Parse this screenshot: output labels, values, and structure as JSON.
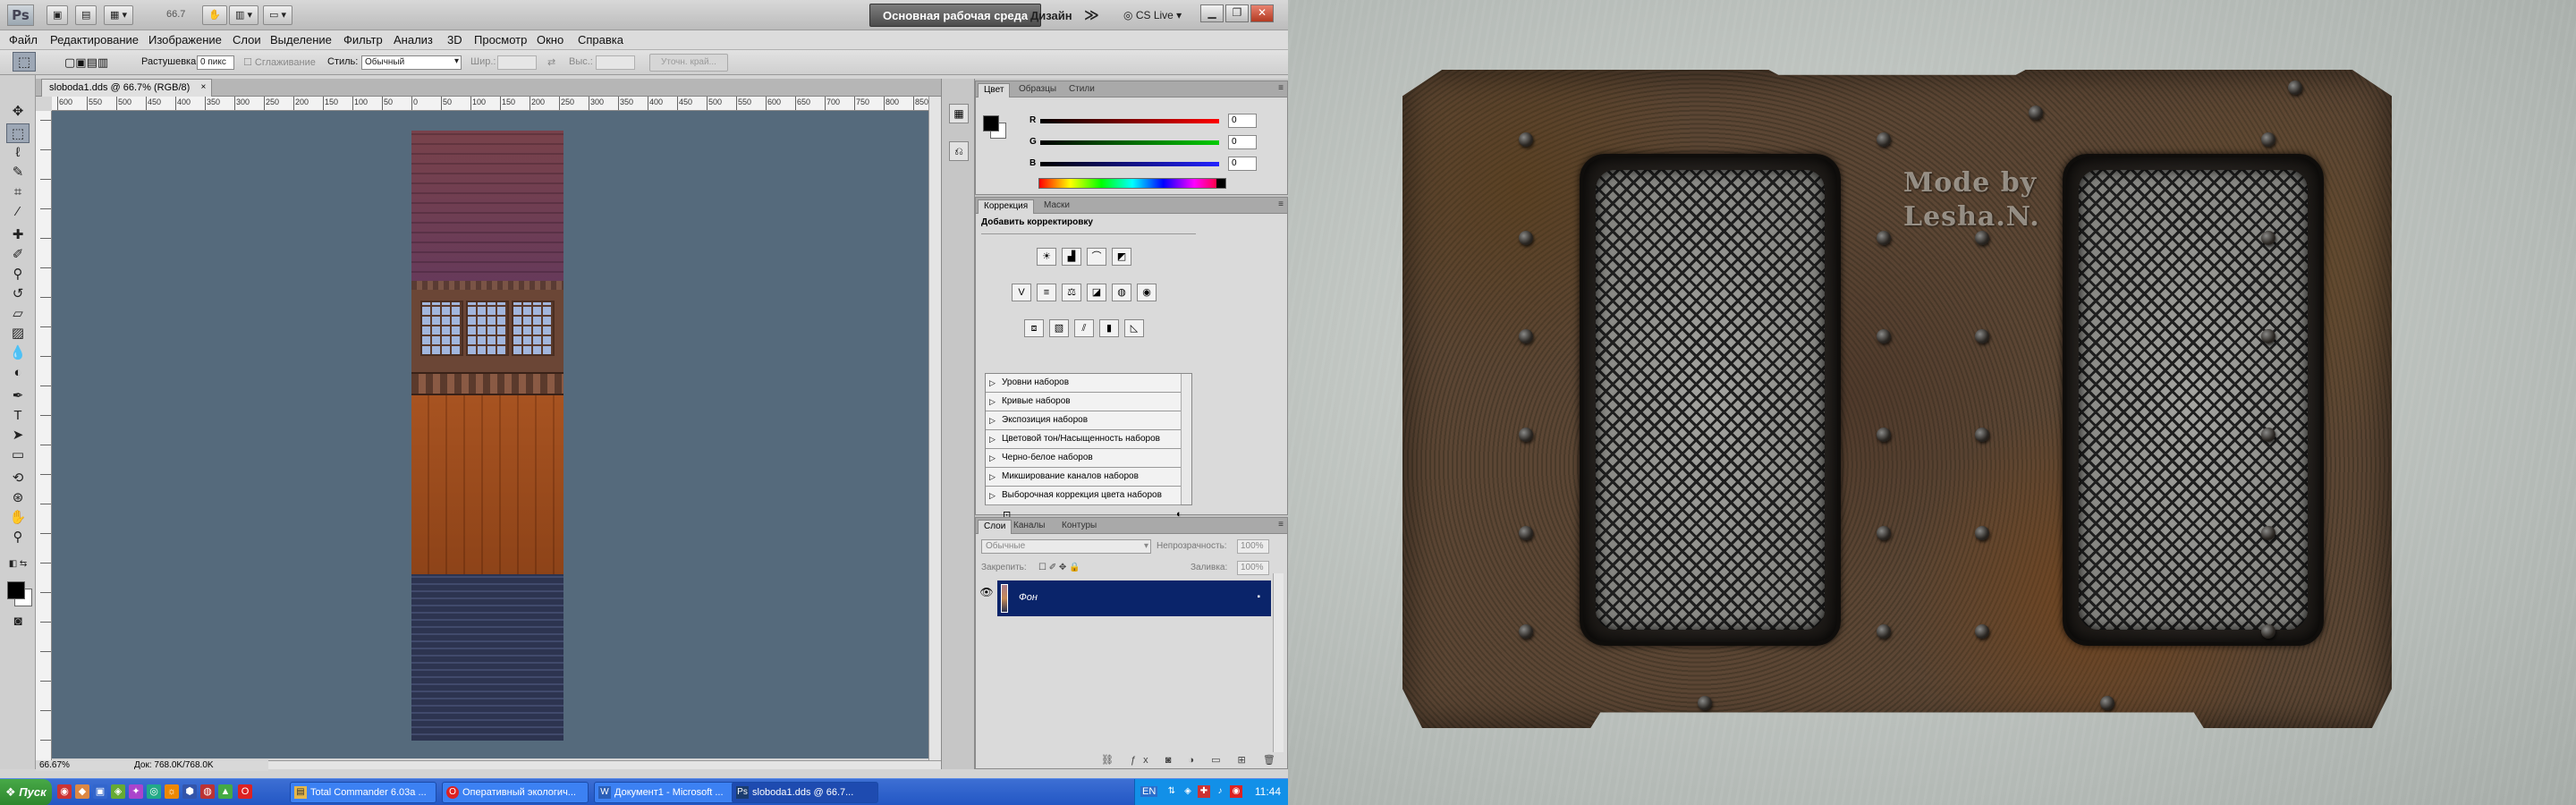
{
  "photoshop": {
    "appbar": {
      "logo": "Ps",
      "zoom": "66.7",
      "workspace_main": "Основная рабочая среда",
      "workspace_design": "Дизайн",
      "workspace_more": "≫",
      "cs_live": "CS Live"
    },
    "menu": [
      "Файл",
      "Редактирование",
      "Изображение",
      "Слои",
      "Выделение",
      "Фильтр",
      "Анализ",
      "3D",
      "Просмотр",
      "Окно",
      "Справка"
    ],
    "options": {
      "feather_label": "Растушевка:",
      "feather_value": "0 пикс",
      "antialias_label": "Сглаживание",
      "style_label": "Стиль:",
      "style_value": "Обычный",
      "width_label": "Шир.:",
      "height_label": "Выс.:",
      "refine_edge": "Уточн. край..."
    },
    "document": {
      "tab_title": "sloboda1.dds @ 66.7% (RGB/8)",
      "close": "×",
      "ruler_numbers": [
        "600",
        "550",
        "500",
        "450",
        "400",
        "350",
        "300",
        "250",
        "200",
        "150",
        "100",
        "50",
        "0",
        "50",
        "100",
        "150",
        "200",
        "250",
        "300",
        "350",
        "400",
        "450",
        "500",
        "550",
        "600",
        "650",
        "700",
        "750",
        "800",
        "850"
      ]
    },
    "status": {
      "zoom": "66.67%",
      "doc": "Док: 768.0K/768.0K"
    },
    "color_panel": {
      "tabs": [
        "Цвет",
        "Образцы",
        "Стили"
      ],
      "channels": [
        {
          "label": "R",
          "value": "0",
          "color": "#e02020"
        },
        {
          "label": "G",
          "value": "0",
          "color": "#20b020"
        },
        {
          "label": "B",
          "value": "0",
          "color": "#2040e0"
        }
      ]
    },
    "adjustments_panel": {
      "tabs": [
        "Коррекция",
        "Маски"
      ],
      "heading": "Добавить корректировку",
      "presets": [
        "Уровни наборов",
        "Кривые наборов",
        "Экспозиция наборов",
        "Цветовой тон/Насыщенность наборов",
        "Черно-белое наборов",
        "Микширование каналов наборов",
        "Выборочная коррекция цвета наборов"
      ]
    },
    "layers_panel": {
      "tabs": [
        "Слои",
        "Каналы",
        "Контуры"
      ],
      "blend_mode": "Обычные",
      "opacity_label": "Непрозрачность:",
      "opacity_value": "100%",
      "lock_label": "Закрепить:",
      "fill_label": "Заливка:",
      "fill_value": "100%",
      "layer_name": "Фон"
    }
  },
  "taskbar": {
    "start": "Пуск",
    "tasks": [
      {
        "label": "Total Commander 6.03a ...",
        "icon": "folder-icon"
      },
      {
        "label": "Оперативный экологич...",
        "icon": "opera-icon"
      },
      {
        "label": "Документ1 - Microsoft ...",
        "icon": "word-icon"
      },
      {
        "label": "sloboda1.dds @ 66.7...",
        "icon": "photoshop-icon"
      }
    ],
    "lang": "EN",
    "clock": "11:44"
  },
  "viewer": {
    "watermark_line1": "Mode by",
    "watermark_line2": "Lesha.N."
  }
}
